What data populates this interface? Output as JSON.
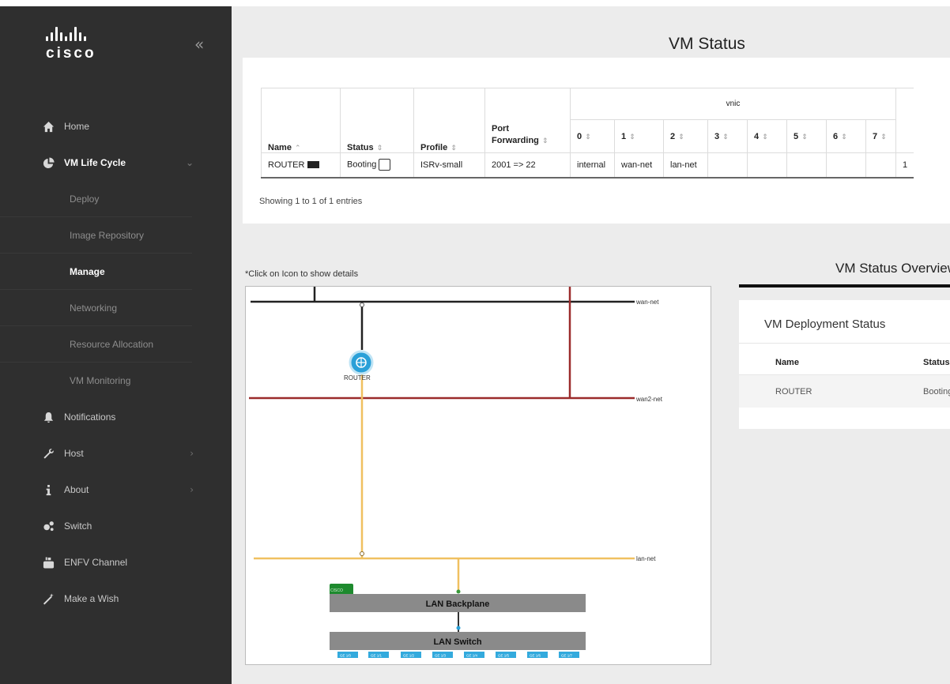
{
  "brand": {
    "logo_text": "cisco"
  },
  "sidebar": {
    "items": [
      {
        "label": "Home",
        "icon": "home-icon"
      },
      {
        "label": "VM Life Cycle",
        "icon": "pie-chart-icon",
        "sub": [
          "Deploy",
          "Image Repository",
          "Manage",
          "Networking",
          "Resource Allocation",
          "VM Monitoring"
        ],
        "current_sub": "Manage"
      },
      {
        "label": "Notifications",
        "icon": "bell-icon"
      },
      {
        "label": "Host",
        "icon": "wrench-icon"
      },
      {
        "label": "About",
        "icon": "info-icon"
      },
      {
        "label": "Switch",
        "icon": "gears-icon"
      },
      {
        "label": "ENFV Channel",
        "icon": "youtube-icon"
      },
      {
        "label": "Make a Wish",
        "icon": "magic-wand-icon"
      }
    ]
  },
  "vm_status": {
    "title": "VM Status",
    "columns": {
      "name": "Name",
      "status": "Status",
      "profile": "Profile",
      "port_forwarding": "Port Forwarding",
      "vnic": "vnic"
    },
    "vnic_cols": [
      "0",
      "1",
      "2",
      "3",
      "4",
      "5",
      "6",
      "7"
    ],
    "rows": [
      {
        "name": "ROUTER",
        "status": "Booting",
        "profile": "ISRv-small",
        "port_forwarding": "2001 => 22",
        "vnics": [
          "internal",
          "wan-net",
          "lan-net",
          "",
          "",
          "",
          "",
          ""
        ],
        "trailing": "1"
      }
    ],
    "showing": "Showing 1 to 1 of 1 entries"
  },
  "topology": {
    "note": "*Click on Icon to show details",
    "networks": {
      "wan": "wan-net",
      "wan2": "wan2-net",
      "lan": "lan-net"
    },
    "router_label": "ROUTER",
    "backplane_label": "LAN Backplane",
    "switch_label": "LAN Switch",
    "cisco_tag": "CISCO",
    "ports": [
      "GE 1/0",
      "GE 1/1",
      "GE 1/2",
      "GE 1/3",
      "GE 1/4",
      "GE 1/5",
      "GE 1/6",
      "GE 1/7"
    ],
    "colors": {
      "wan": "#222222",
      "wan2": "#9b2b2b",
      "lan": "#f0c060",
      "router": "#2aa0d8"
    }
  },
  "overview": {
    "title": "VM Status Overview",
    "sub_title": "VM Deployment Status",
    "col_name": "Name",
    "col_status": "Status",
    "row_name": "ROUTER",
    "row_status": "Booting"
  }
}
